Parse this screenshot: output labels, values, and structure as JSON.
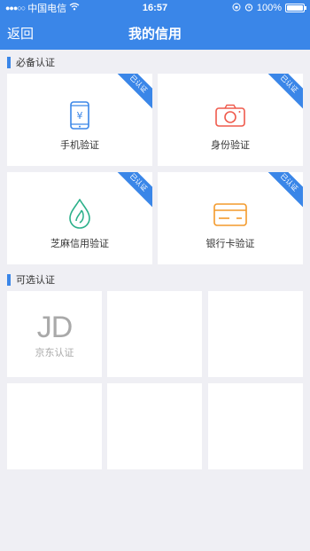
{
  "status_bar": {
    "carrier": "中国电信",
    "time": "16:57",
    "battery_percent": "100%",
    "battery_level": 1.0
  },
  "nav": {
    "back_label": "返回",
    "title": "我的信用"
  },
  "required_section": {
    "title": "必备认证",
    "items": [
      {
        "label": "手机验证",
        "badge": "已认证",
        "icon": "phone-icon",
        "color": "#3a86e8"
      },
      {
        "label": "身份验证",
        "badge": "已认证",
        "icon": "camera-icon",
        "color": "#ef5a4c"
      },
      {
        "label": "芝麻信用验证",
        "badge": "已认证",
        "icon": "sesame-drop-icon",
        "color": "#2bb08a"
      },
      {
        "label": "银行卡验证",
        "badge": "已认证",
        "icon": "bank-card-icon",
        "color": "#f39a2b"
      }
    ]
  },
  "optional_section": {
    "title": "可选认证",
    "items": [
      {
        "logo": "JD",
        "label": "京东认证"
      }
    ]
  },
  "colors": {
    "accent": "#3a86e8",
    "background": "#efeff4",
    "card": "#ffffff"
  }
}
